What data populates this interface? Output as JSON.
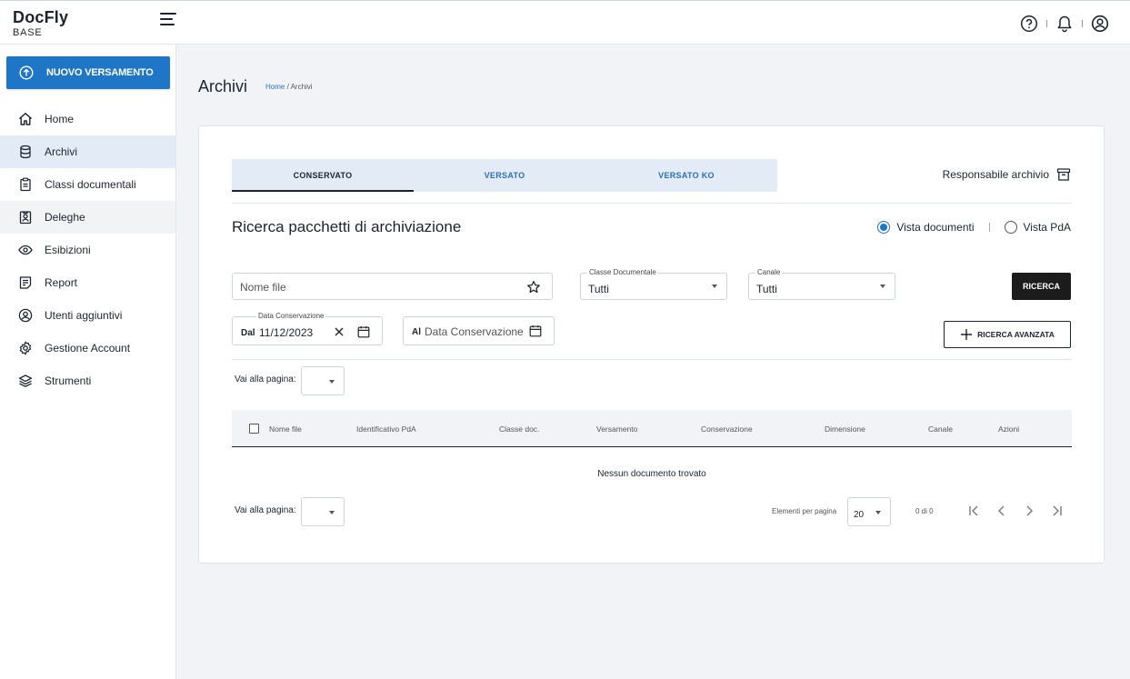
{
  "app": {
    "name": "DocFly",
    "edition": "BASE"
  },
  "sidebar": {
    "new_button": "NUOVO VERSAMENTO",
    "items": [
      {
        "label": "Home",
        "icon": "home-icon"
      },
      {
        "label": "Archivi",
        "icon": "database-icon"
      },
      {
        "label": "Classi documentali",
        "icon": "clipboard-icon"
      },
      {
        "label": "Deleghe",
        "icon": "badge-icon"
      },
      {
        "label": "Esibizioni",
        "icon": "eye-icon"
      },
      {
        "label": "Report",
        "icon": "report-icon"
      },
      {
        "label": "Utenti aggiuntivi",
        "icon": "user-circle-icon"
      },
      {
        "label": "Gestione Account",
        "icon": "gear-icon"
      },
      {
        "label": "Strumenti",
        "icon": "layers-icon"
      }
    ]
  },
  "page": {
    "title": "Archivi",
    "breadcrumb_home": "Home",
    "breadcrumb_current": "/ Archivi"
  },
  "tabs": [
    "CONSERVATO",
    "VERSATO",
    "VERSATO KO"
  ],
  "responsabile": "Responsabile archivio",
  "section_title": "Ricerca pacchetti di archiviazione",
  "view": {
    "documents": "Vista documenti",
    "pda": "Vista PdA",
    "selected": "documents"
  },
  "filters": {
    "nome_file_placeholder": "Nome file",
    "classe_label": "Classe Documentale",
    "classe_value": "Tutti",
    "canale_label": "Canale",
    "canale_value": "Tutti",
    "data_label": "Data Conservazione",
    "dal_prefix": "Dal",
    "dal_value": "11/12/2023",
    "al_prefix": "Al",
    "al_placeholder": "Data Conservazione"
  },
  "buttons": {
    "search": "RICERCA",
    "advanced": "RICERCA AVANZATA"
  },
  "pager": {
    "goto_label": "Vai alla pagina:",
    "per_page_label": "Elementi per pagina",
    "per_page_value": "20",
    "count": "0 di 0"
  },
  "table": {
    "columns": [
      "Nome file",
      "Identificativo PdA",
      "Classe doc.",
      "Versamento",
      "Conservazione",
      "Dimensione",
      "Canale",
      "Azioni"
    ],
    "empty": "Nessun documento trovato"
  }
}
